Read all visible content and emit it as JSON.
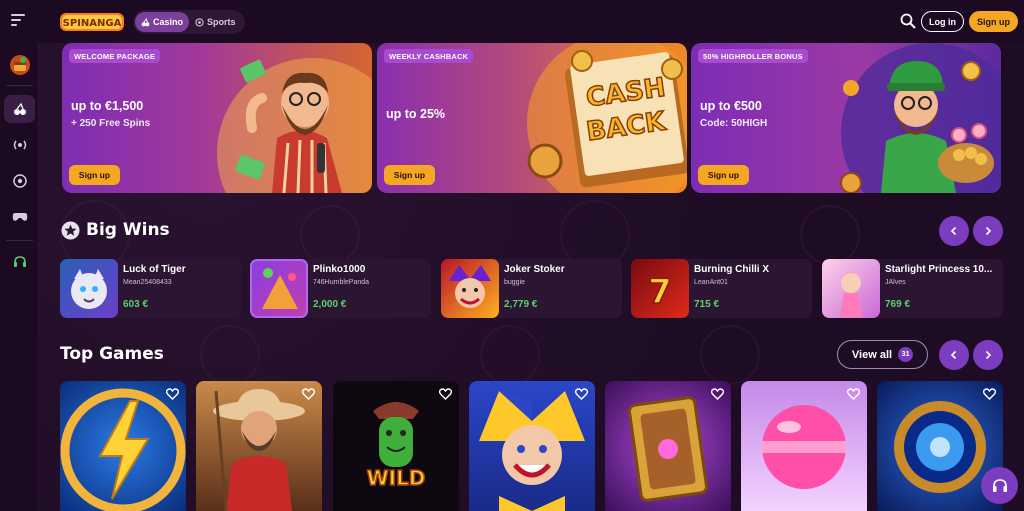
{
  "header": {
    "logo_text": "SPINANGA",
    "tabs": [
      {
        "label": "Casino",
        "active": true
      },
      {
        "label": "Sports",
        "active": false
      }
    ],
    "login_label": "Log in",
    "signup_label": "Sign up"
  },
  "sidebar": {
    "items": [
      {
        "icon": "bonus-chest-icon"
      },
      {
        "icon": "casino-cherries-icon"
      },
      {
        "icon": "live-broadcast-icon"
      },
      {
        "icon": "sports-ball-icon"
      },
      {
        "icon": "gamepad-icon"
      },
      {
        "icon": "headset-icon"
      }
    ]
  },
  "banners": [
    {
      "badge": "WELCOME PACKAGE",
      "headline": "up to €1,500",
      "sub": "+ 250 Free Spins",
      "button": "Sign up"
    },
    {
      "badge": "WEEKLY CASHBACK",
      "headline": "up to 25%",
      "sub": "",
      "button": "Sign up",
      "art_text_1": "CASH",
      "art_text_2": "BACK"
    },
    {
      "badge": "50% HIGHROLLER BONUS",
      "headline": "up to €500",
      "sub": "Code: 50HIGH",
      "button": "Sign up"
    }
  ],
  "big_wins": {
    "title": "Big Wins",
    "items": [
      {
        "game": "Luck of Tiger",
        "user": "Mean25408433",
        "amount": "603 €"
      },
      {
        "game": "Plinko1000",
        "user": "746HumblePanda",
        "amount": "2,000 €"
      },
      {
        "game": "Joker Stoker",
        "user": "buggie",
        "amount": "2,779 €"
      },
      {
        "game": "Burning Chilli X",
        "user": "LeanAnt01",
        "amount": "715 €"
      },
      {
        "game": "Starlight Princess 10...",
        "user": "JAlves",
        "amount": "769 €"
      }
    ]
  },
  "top_games": {
    "title": "Top Games",
    "view_all_label": "View all",
    "count": "31",
    "games": [
      {
        "art": "lightning-coin"
      },
      {
        "art": "fisherman"
      },
      {
        "art": "wild-cactus",
        "label": "WILD"
      },
      {
        "art": "jester"
      },
      {
        "art": "golden-book"
      },
      {
        "art": "pink-candy"
      },
      {
        "art": "portal-coin"
      }
    ]
  },
  "colors": {
    "background": "#1e0c24",
    "accent_purple": "#7c3cbf",
    "accent_orange": "#f5a623",
    "win_green": "#59d36a"
  }
}
